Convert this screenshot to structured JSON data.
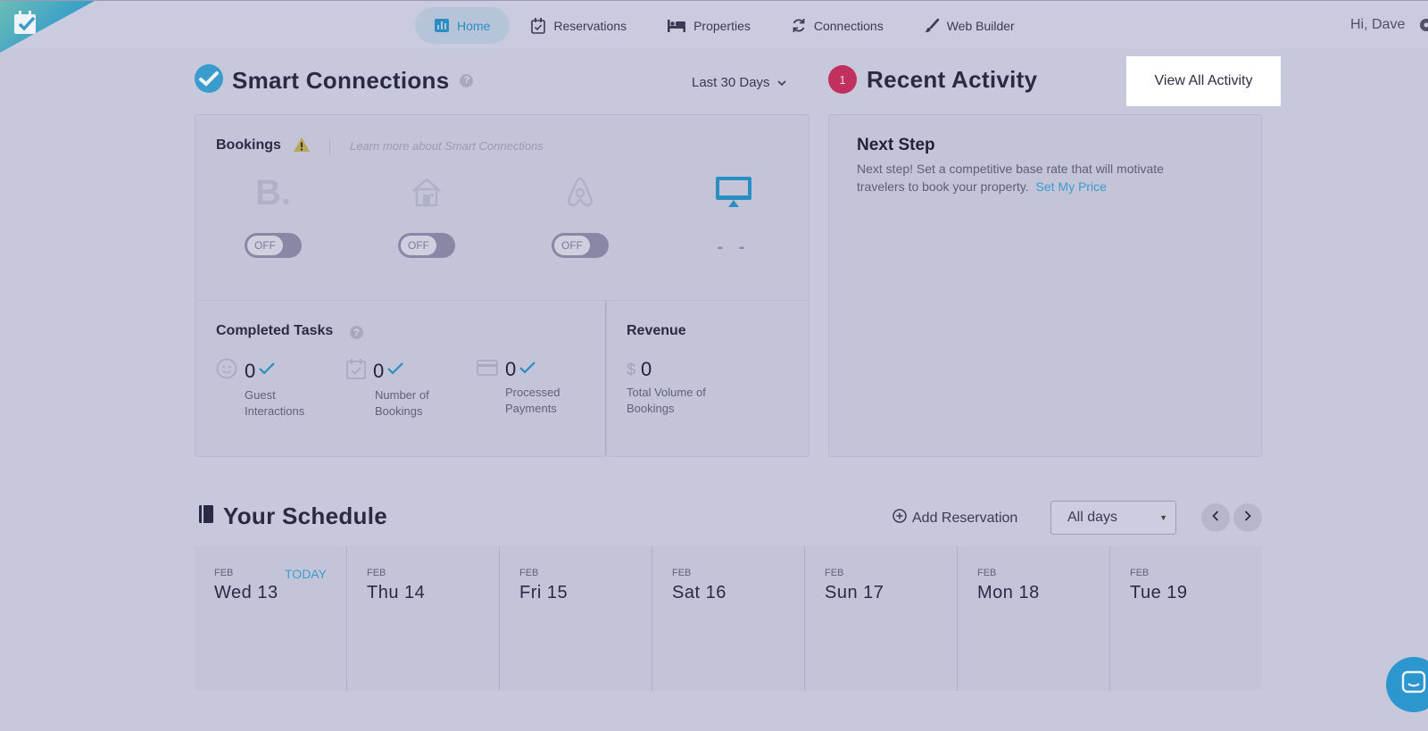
{
  "nav": {
    "items": [
      {
        "label": "Home",
        "icon": "bar-chart-icon",
        "active": true
      },
      {
        "label": "Reservations",
        "icon": "calendar-check-icon",
        "active": false
      },
      {
        "label": "Properties",
        "icon": "bed-icon",
        "active": false
      },
      {
        "label": "Connections",
        "icon": "sync-icon",
        "active": false
      },
      {
        "label": "Web Builder",
        "icon": "brush-icon",
        "active": false
      }
    ],
    "greeting": "Hi, Dave"
  },
  "smart_connections": {
    "title": "Smart Connections",
    "help": "?",
    "range": "Last 30 Days",
    "bookings_label": "Bookings",
    "learn_more": "Learn more about Smart Connections",
    "channels": [
      {
        "name": "booking-com",
        "icon": "booking-b-icon",
        "state": "OFF"
      },
      {
        "name": "homeaway",
        "icon": "house-icon",
        "state": "OFF"
      },
      {
        "name": "airbnb",
        "icon": "airbnb-icon",
        "state": "OFF"
      },
      {
        "name": "website",
        "icon": "monitor-icon",
        "state": "- -"
      }
    ]
  },
  "tasks": {
    "title": "Completed Tasks",
    "help": "?",
    "stats": [
      {
        "value": "0",
        "caption": "Guest Interactions",
        "icon": "smiley-icon"
      },
      {
        "value": "0",
        "caption": "Number of Bookings",
        "icon": "calendar-check-icon"
      },
      {
        "value": "0",
        "caption": "Processed Payments",
        "icon": "credit-card-icon"
      }
    ]
  },
  "revenue": {
    "title": "Revenue",
    "currency": "$",
    "value": "0",
    "caption": "Total Volume of Bookings"
  },
  "activity": {
    "badge": "1",
    "title": "Recent Activity",
    "view_all": "View All Activity",
    "next_step_title": "Next Step",
    "next_step_text": "Next step! Set a competitive base rate that will motivate travelers to book your property.",
    "next_step_link": "Set My Price"
  },
  "schedule": {
    "title": "Your Schedule",
    "add_reservation": "Add Reservation",
    "filter": "All days",
    "days": [
      {
        "month": "FEB",
        "label": "Wed 13",
        "today": "TODAY"
      },
      {
        "month": "FEB",
        "label": "Thu 14",
        "today": ""
      },
      {
        "month": "FEB",
        "label": "Fri 15",
        "today": ""
      },
      {
        "month": "FEB",
        "label": "Sat 16",
        "today": ""
      },
      {
        "month": "FEB",
        "label": "Sun 17",
        "today": ""
      },
      {
        "month": "FEB",
        "label": "Mon 18",
        "today": ""
      },
      {
        "month": "FEB",
        "label": "Tue 19",
        "today": ""
      }
    ]
  },
  "colors": {
    "accent": "#2a8fc0",
    "badge": "#c0315d",
    "overlay": "#c8c8dc"
  }
}
